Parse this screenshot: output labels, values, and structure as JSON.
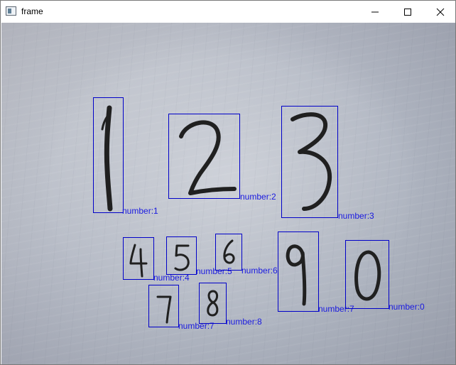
{
  "window": {
    "title": "frame",
    "icon": "app-window-icon",
    "controls": [
      "minimize-icon",
      "maximize-icon",
      "close-icon"
    ]
  },
  "detections": [
    {
      "digit": "1",
      "label": "number:1"
    },
    {
      "digit": "2",
      "label": "number:2"
    },
    {
      "digit": "3",
      "label": "number:3"
    },
    {
      "digit": "4",
      "label": "number:4"
    },
    {
      "digit": "5",
      "label": "number:5"
    },
    {
      "digit": "6",
      "label": "number:6"
    },
    {
      "digit": "9",
      "label": "number:7"
    },
    {
      "digit": "0",
      "label": "number:0"
    },
    {
      "digit": "7",
      "label": "number:7"
    },
    {
      "digit": "8",
      "label": "number:8"
    }
  ],
  "colors": {
    "box": "#0000c8",
    "label": "#1a1ae0",
    "ink": "#202020"
  }
}
